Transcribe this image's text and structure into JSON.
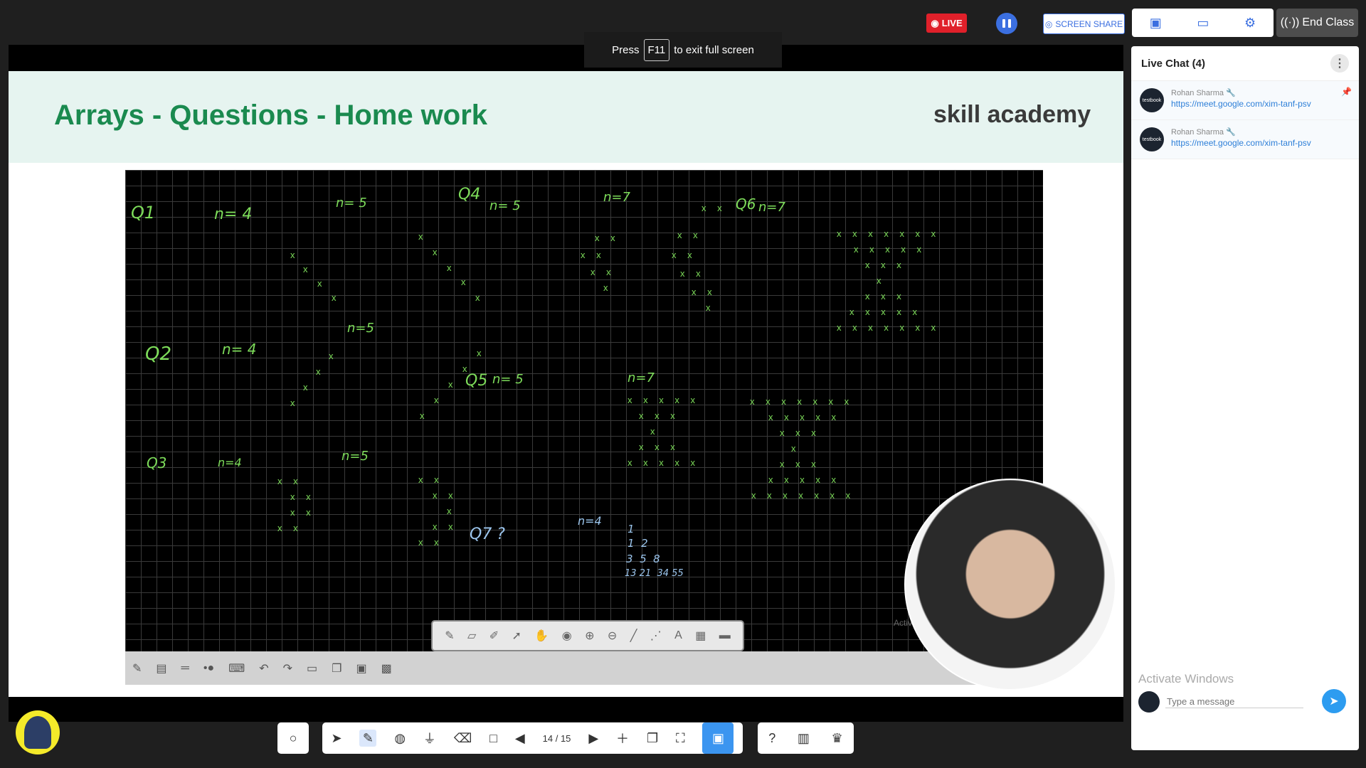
{
  "topbar": {
    "live_label": "LIVE",
    "screen_share_label": "SCREEN SHARE",
    "end_class_label": "End Class"
  },
  "f11_notice": {
    "press": "Press",
    "key": "F11",
    "suffix": "to exit full screen"
  },
  "slide": {
    "title": "Arrays - Questions - Home work",
    "brand": "skill academy"
  },
  "board_notes": {
    "q1": "Q1",
    "q1_n": "n= 4",
    "q1_n2": "n= 5",
    "q4": "Q4",
    "q4_n": "n= 5",
    "q4_n2": "n=7",
    "q6": "Q6",
    "q6_n": "n=7",
    "q2": "Q2",
    "q2_n": "n= 4",
    "q2_n2": "n=5",
    "q5": "Q5",
    "q5_n": "n= 5",
    "q5_n2": "n=7",
    "q3": "Q3",
    "q3_n": "n=4",
    "q3_n2": "n=5",
    "q7": "Q7 ?",
    "q7_n": "n=4",
    "q7_rows": [
      "1",
      "1  2",
      "3  5  8",
      "13 21  34 55"
    ]
  },
  "bottom_toolbar": {
    "page_indicator": "14 / 15"
  },
  "chat": {
    "title": "Live Chat (4)",
    "messages": [
      {
        "sender": "Rohan Sharma",
        "text": "https://meet.google.com/xim-tanf-psv",
        "avatar": "testbook"
      },
      {
        "sender": "Rohan Sharma",
        "text": "https://meet.google.com/xim-tanf-psv",
        "avatar": "testbook"
      }
    ],
    "input_placeholder": "Type a message",
    "activate_windows": "Activate Windows"
  },
  "colors": {
    "live": "#e0202a",
    "accent": "#3b6fe0",
    "slide_title": "#1a8a4f",
    "board_ink": "#7ddc5a",
    "send": "#2d9cf0"
  }
}
